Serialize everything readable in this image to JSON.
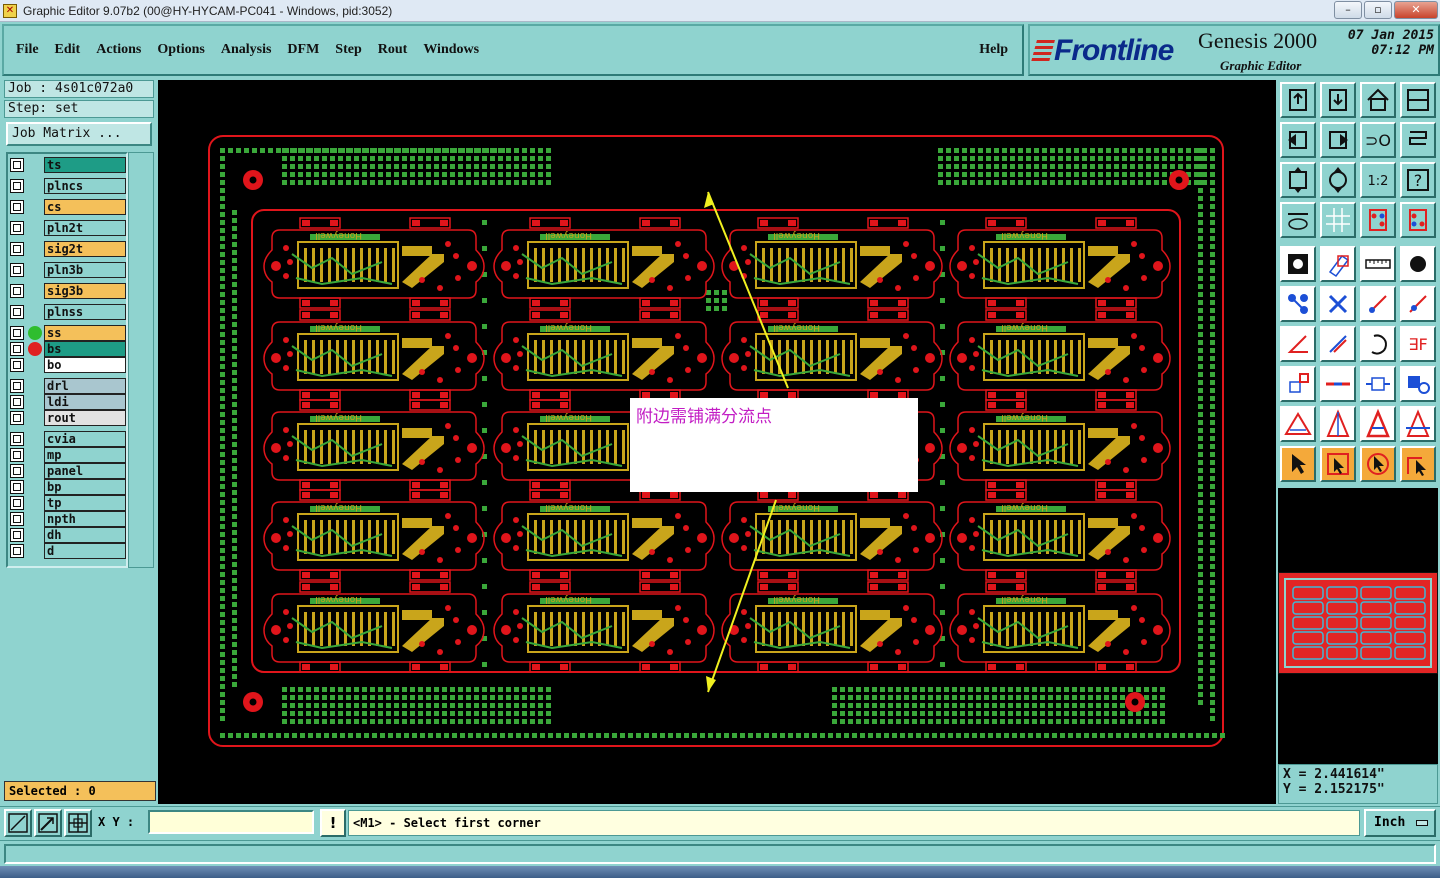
{
  "window": {
    "title": "Graphic Editor 9.07b2 (00@HY-HYCAM-PC041 - Windows, pid:3052)",
    "buttons": [
      "minimize",
      "maximize",
      "close"
    ]
  },
  "menu": {
    "items": [
      {
        "label": "File"
      },
      {
        "label": "Edit"
      },
      {
        "label": "Actions"
      },
      {
        "label": "Options"
      },
      {
        "label": "Analysis"
      },
      {
        "label": "DFM"
      },
      {
        "label": "Step"
      },
      {
        "label": "Rout"
      },
      {
        "label": "Windows"
      }
    ],
    "help": "Help"
  },
  "brand": {
    "logo": "Frontline",
    "product": "Genesis 2000",
    "subtitle": "Graphic Editor",
    "date": "07 Jan 2015",
    "time": "07:12 PM"
  },
  "job": {
    "job_line": "Job : 4s01c072a0",
    "step_line": "Step: set",
    "matrix_button": "Job Matrix ..."
  },
  "layers": [
    {
      "name": "ts",
      "color": "#1e9c86",
      "dot": ""
    },
    {
      "name": "plncs",
      "color": "#8fd3cf",
      "dot": ""
    },
    {
      "name": "cs",
      "color": "#f4c05a",
      "dot": ""
    },
    {
      "name": "pln2t",
      "color": "#8fd3cf",
      "dot": ""
    },
    {
      "name": "sig2t",
      "color": "#f4c05a",
      "dot": ""
    },
    {
      "name": "pln3b",
      "color": "#8fd3cf",
      "dot": ""
    },
    {
      "name": "sig3b",
      "color": "#f4c05a",
      "dot": ""
    },
    {
      "name": "plnss",
      "color": "#8fd3cf",
      "dot": ""
    },
    {
      "name": "ss",
      "color": "#f4c05a",
      "dot": "#2fbd2f"
    },
    {
      "name": "bs",
      "color": "#1e9c86",
      "dot": "#e02020"
    },
    {
      "name": "bo",
      "color": "#ffffff",
      "dot": ""
    },
    {
      "name": "drl",
      "color": "#a9c6cf",
      "dot": ""
    },
    {
      "name": "ldi",
      "color": "#a9c6cf",
      "dot": ""
    },
    {
      "name": "rout",
      "color": "#e2e2e2",
      "dot": ""
    },
    {
      "name": "cvia",
      "color": "#8fd3cf",
      "dot": ""
    },
    {
      "name": "mp",
      "color": "#8fd3cf",
      "dot": ""
    },
    {
      "name": "panel",
      "color": "#8fd3cf",
      "dot": ""
    },
    {
      "name": "bp",
      "color": "#8fd3cf",
      "dot": ""
    },
    {
      "name": "tp",
      "color": "#8fd3cf",
      "dot": ""
    },
    {
      "name": "npth",
      "color": "#8fd3cf",
      "dot": ""
    },
    {
      "name": "dh",
      "color": "#8fd3cf",
      "dot": ""
    },
    {
      "name": "d",
      "color": "#8fd3cf",
      "dot": ""
    }
  ],
  "selected": "Selected : 0",
  "canvas": {
    "annotation": "附边需铺满分流点",
    "board_label": "Honeywell",
    "rows": 5,
    "cols": 4,
    "colors": {
      "outline": "#e0151b",
      "pad": "#e0151b",
      "copper": "#c9a51b",
      "mask": "#3aa83a",
      "arrow": "#f0f020"
    }
  },
  "toolbox": {
    "icons": [
      "zoom-home-icon",
      "zoom-in-icon",
      "home-icon",
      "window-icon",
      "pan-left-icon",
      "pan-right-icon",
      "mirror-icon",
      "snap-icon",
      "fit-icon",
      "center-icon",
      "scale-icon",
      "help-icon",
      "measure-icon",
      "grid-icon",
      "layers-icon",
      "layers-alt-icon",
      "pad-icon",
      "slot-icon",
      "ruler-icon",
      "circle-icon",
      "node-icon",
      "cross-icon",
      "line-icon",
      "vertex-icon",
      "angle-icon",
      "diagonal-icon",
      "rotate-icon",
      "fill-icon",
      "select-area-icon",
      "split-icon",
      "resize-icon",
      "group-icon",
      "triangle-icon",
      "triangle-a-icon",
      "triangle-b-icon",
      "triangle-c-icon",
      "pointer-icon",
      "pointer-box-icon",
      "pointer-circle-icon",
      "pointer-step-icon"
    ]
  },
  "coords": {
    "x": "X = 2.441614\"",
    "y": "Y = 2.152175\""
  },
  "statusbar": {
    "xy_label": "X Y :",
    "xy_value": "",
    "message": "<M1> - Select first corner",
    "unit": "Inch"
  }
}
